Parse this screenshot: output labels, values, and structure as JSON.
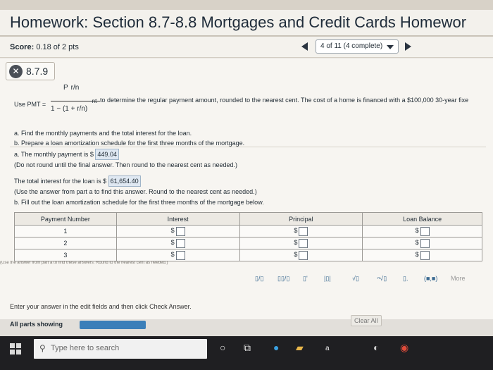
{
  "header": {
    "title": "Homework: Section 8.7-8.8 Mortgages and Credit Cards Homewor"
  },
  "score": {
    "label": "Score:",
    "value": "0.18 of 2 pts"
  },
  "progress": {
    "text": "4 of 11 (4 complete)"
  },
  "question": {
    "number": "8.7.9"
  },
  "formula": {
    "lead": "Use PMT =",
    "numerator": "P",
    "numer_inner": "r/n",
    "denominator": "1 − (1 + r/n)",
    "exponent": "−nt",
    "description": "to determine the regular payment amount, rounded to the nearest cent. The cost of a home is financed with a $100,000 30-year fixe"
  },
  "parts": {
    "a": "a. Find the monthly payments and the total interest for the loan.",
    "b": "b. Prepare a loan amortization schedule for the first three months of the mortgage."
  },
  "answer_a": {
    "prefix": "a. The monthly payment is $",
    "value": "449.04",
    "note": "(Do not round until the final answer. Then round to the nearest cent as needed.)"
  },
  "answer_b": {
    "prefix": "The total interest for the loan is $",
    "value": "61,654.40",
    "note": "(Use the answer from part a to find this answer. Round to the nearest cent as needed.)"
  },
  "table": {
    "intro": "b. Fill out the loan amortization schedule for the first three months of the mortgage below.",
    "headers": [
      "Payment Number",
      "Interest",
      "Principal",
      "Loan Balance"
    ],
    "rows": [
      "1",
      "2",
      "3"
    ],
    "currency": "$"
  },
  "cutoff_text": "(Use the answer from part a to find these answers. Round to the nearest cent as needed.)",
  "toolbar": {
    "more": "More",
    "mixed": "(■,■)"
  },
  "footer": {
    "hint": "Enter your answer in the edit fields and then click Check Answer.",
    "all_parts": "All parts showing",
    "clear_all": "Clear All"
  },
  "taskbar": {
    "search_placeholder": "Type here to search"
  },
  "colors": {
    "accent": "#3b7fb9",
    "answer_bg": "#dfe8f2"
  }
}
